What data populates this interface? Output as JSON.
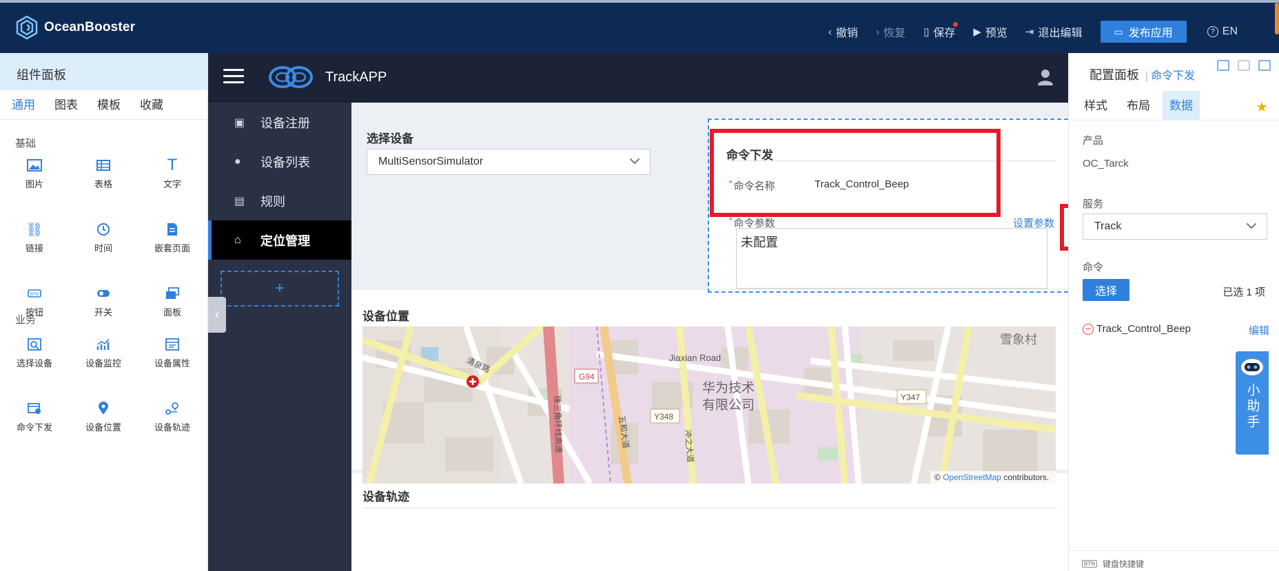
{
  "topbar": {
    "brand": "OceanBooster",
    "actions": {
      "undo": "撤销",
      "redo": "恢复",
      "save": "保存",
      "preview": "预览",
      "exit": "退出编辑",
      "publish": "发布应用",
      "lang": "EN"
    }
  },
  "components_panel": {
    "title": "组件面板",
    "tabs": [
      "通用",
      "图表",
      "模板",
      "收藏"
    ],
    "active_tab": "通用",
    "sections": [
      {
        "title": "基础",
        "items": [
          {
            "label": "图片",
            "icon": "image-icon"
          },
          {
            "label": "表格",
            "icon": "table-icon"
          },
          {
            "label": "文字",
            "icon": "text-icon"
          },
          {
            "label": "链接",
            "icon": "link-icon"
          },
          {
            "label": "时间",
            "icon": "clock-icon"
          },
          {
            "label": "嵌套页面",
            "icon": "nested-page-icon"
          },
          {
            "label": "按钮",
            "icon": "button-icon"
          },
          {
            "label": "开关",
            "icon": "switch-icon"
          },
          {
            "label": "面板",
            "icon": "panel-icon"
          }
        ]
      },
      {
        "title": "业务",
        "items": [
          {
            "label": "选择设备",
            "icon": "select-device-icon"
          },
          {
            "label": "设备监控",
            "icon": "device-monitor-icon"
          },
          {
            "label": "设备属性",
            "icon": "device-attr-icon"
          },
          {
            "label": "命令下发",
            "icon": "command-icon"
          },
          {
            "label": "设备位置",
            "icon": "location-pin-icon"
          },
          {
            "label": "设备轨迹",
            "icon": "track-icon"
          }
        ]
      }
    ]
  },
  "app": {
    "name": "TrackAPP",
    "nav": [
      {
        "label": "设备注册",
        "icon": "register-icon",
        "active": false
      },
      {
        "label": "设备列表",
        "icon": "list-icon",
        "active": false
      },
      {
        "label": "规则",
        "icon": "rule-icon",
        "active": false
      },
      {
        "label": "定位管理",
        "icon": "location-manage-icon",
        "active": true
      }
    ],
    "add_label": "+",
    "select_device": {
      "title": "选择设备",
      "value": "MultiSensorSimulator"
    },
    "command": {
      "title": "命令下发",
      "name_label": "命令名称",
      "name_value": "Track_Control_Beep",
      "param_label": "命令参数",
      "param_link": "设置参数",
      "param_value": "未配置"
    },
    "location": {
      "title": "设备位置",
      "map_labels": {
        "road1": "Jiaxian Road",
        "g94": "G94",
        "y348": "Y348",
        "y347": "Y347",
        "company_l1": "华为技术",
        "company_l2": "有限公司",
        "village": "雪象村",
        "qingquan": "清泉路",
        "fiveandroad": "五和大道",
        "chongzhi": "冲之大道",
        "sanjiao": "珠三角环线高速"
      },
      "attribution_prefix": "©",
      "attribution_link": "OpenStreetMap",
      "attribution_suffix": "contributors."
    },
    "track": {
      "title": "设备轨迹"
    }
  },
  "config_panel": {
    "title": "配置面板",
    "subtitle": "命令下发",
    "tabs": [
      "样式",
      "布局",
      "数据"
    ],
    "active_tab": "数据",
    "product_label": "产品",
    "product_value": "OC_Tarck",
    "service_label": "服务",
    "service_value": "Track",
    "command_label": "命令",
    "select_button": "选择",
    "selected_count": "已选 1 项",
    "selected_item": "Track_Control_Beep",
    "edit_link": "编辑",
    "shortcut": "键盘快捷键",
    "shortcut_badge": "BTN"
  },
  "assistant": {
    "label": "小助手"
  },
  "colors": {
    "accent": "#2f80dd",
    "topbar": "#0d2a55",
    "app_header": "#1c2337",
    "app_nav": "#2b3145",
    "highlight_red": "#e41c28"
  }
}
